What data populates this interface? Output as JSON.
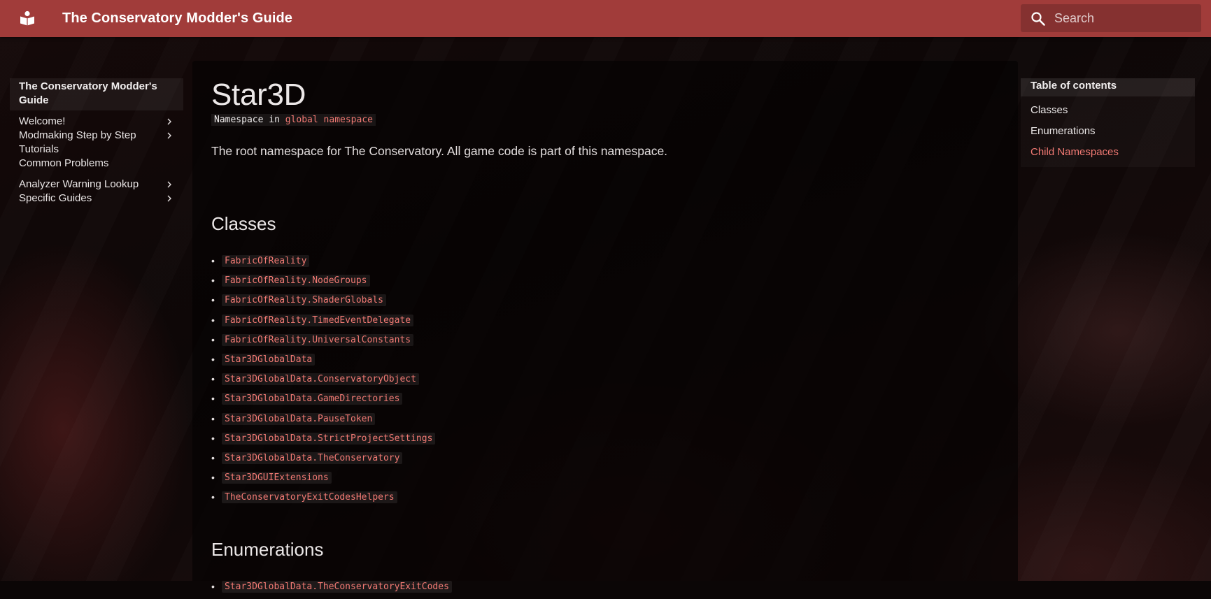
{
  "header": {
    "site_title": "The Conservatory Modder's Guide",
    "search_placeholder": "Search",
    "logo_icon": "book-reader-icon",
    "accent_color": "#a13c3a"
  },
  "sidebar": {
    "title": "The Conservatory Modder's Guide",
    "items": [
      {
        "label": "Welcome!",
        "has_children": true
      },
      {
        "label": "Modmaking Step by Step Tutorials",
        "has_children": true
      },
      {
        "label": "Common Problems",
        "has_children": false
      },
      {
        "label": "Analyzer Warning Lookup",
        "has_children": true
      },
      {
        "label": "Specific Guides",
        "has_children": true
      }
    ]
  },
  "main": {
    "title": "Star3D",
    "namespace_prefix": "Namespace in",
    "namespace_link": "global namespace",
    "description": "The root namespace for The Conservatory. All game code is part of this namespace.",
    "classes_heading": "Classes",
    "classes": [
      "FabricOfReality",
      "FabricOfReality.NodeGroups",
      "FabricOfReality.ShaderGlobals",
      "FabricOfReality.TimedEventDelegate",
      "FabricOfReality.UniversalConstants",
      "Star3DGlobalData",
      "Star3DGlobalData.ConservatoryObject",
      "Star3DGlobalData.GameDirectories",
      "Star3DGlobalData.PauseToken",
      "Star3DGlobalData.StrictProjectSettings",
      "Star3DGlobalData.TheConservatory",
      "Star3DGUIExtensions",
      "TheConservatoryExitCodesHelpers"
    ],
    "enums_heading": "Enumerations",
    "enums": [
      "Star3DGlobalData.TheConservatoryExitCodes"
    ],
    "link_color": "#f27a74"
  },
  "toc": {
    "title": "Table of contents",
    "items": [
      {
        "label": "Classes",
        "active": false
      },
      {
        "label": "Enumerations",
        "active": false
      },
      {
        "label": "Child Namespaces",
        "active": true
      }
    ]
  }
}
